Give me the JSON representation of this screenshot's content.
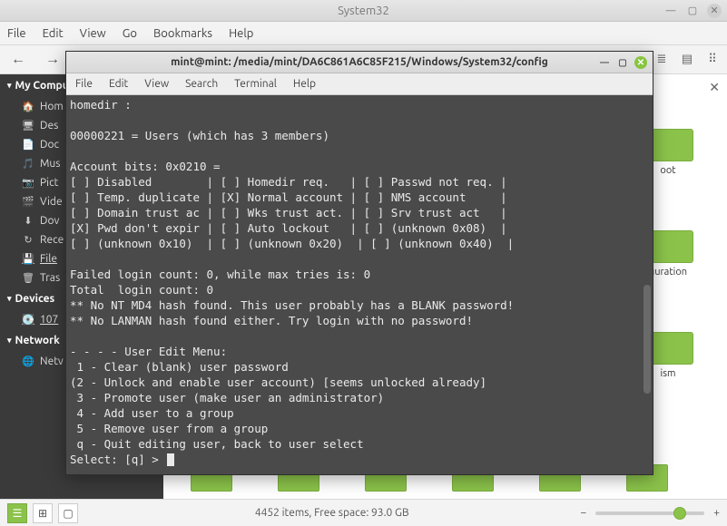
{
  "window": {
    "title": "System32",
    "controls": {
      "min": "—",
      "max": "▢",
      "close": "✕"
    }
  },
  "menubar": {
    "file": "File",
    "edit": "Edit",
    "view": "View",
    "go": "Go",
    "bookmarks": "Bookmarks",
    "help": "Help"
  },
  "toolbar": {
    "back": "←",
    "fwd": "→"
  },
  "sidebar": {
    "sections": {
      "computer": "My Computer",
      "devices": "Devices",
      "network": "Network"
    },
    "computer_items": [
      {
        "icon": "🏠",
        "label": "Hom"
      },
      {
        "icon": "🖥",
        "label": "Des"
      },
      {
        "icon": "📄",
        "label": "Doc"
      },
      {
        "icon": "🎵",
        "label": "Mus"
      },
      {
        "icon": "📷",
        "label": "Pict"
      },
      {
        "icon": "🎬",
        "label": "Vide"
      },
      {
        "icon": "⬇",
        "label": "Dov"
      },
      {
        "icon": "↻",
        "label": "Rece"
      },
      {
        "icon": "💾",
        "label": "File"
      },
      {
        "icon": "🗑",
        "label": "Tras"
      }
    ],
    "device_items": [
      {
        "icon": "💽",
        "label": "107"
      }
    ],
    "network_items": [
      {
        "icon": "🌐",
        "label": "Netv"
      }
    ]
  },
  "folders_right": [
    {
      "name": "oot"
    },
    {
      "name": "guration"
    },
    {
      "name": "ism"
    }
  ],
  "statusbar": {
    "text": "4452 items, Free space: 93.0 GB"
  },
  "terminal": {
    "title": "mint@mint: /media/mint/DA6C861A6C85F215/Windows/System32/config",
    "menubar": {
      "file": "File",
      "edit": "Edit",
      "view": "View",
      "search": "Search",
      "terminal": "Terminal",
      "help": "Help"
    },
    "lines": [
      "homedir :",
      "",
      "00000221 = Users (which has 3 members)",
      "",
      "Account bits: 0x0210 =",
      "[ ] Disabled        | [ ] Homedir req.   | [ ] Passwd not req. |",
      "[ ] Temp. duplicate | [X] Normal account | [ ] NMS account     |",
      "[ ] Domain trust ac | [ ] Wks trust act. | [ ] Srv trust act   |",
      "[X] Pwd don't expir | [ ] Auto lockout   | [ ] (unknown 0x08)  |",
      "[ ] (unknown 0x10)  | [ ] (unknown 0x20)  | [ ] (unknown 0x40)  |",
      "",
      "Failed login count: 0, while max tries is: 0",
      "Total  login count: 0",
      "** No NT MD4 hash found. This user probably has a BLANK password!",
      "** No LANMAN hash found either. Try login with no password!",
      "",
      "- - - - User Edit Menu:",
      " 1 - Clear (blank) user password",
      "(2 - Unlock and enable user account) [seems unlocked already]",
      " 3 - Promote user (make user an administrator)",
      " 4 - Add user to a group",
      " 5 - Remove user from a group",
      " q - Quit editing user, back to user select"
    ],
    "prompt": "Select: [q] > "
  }
}
